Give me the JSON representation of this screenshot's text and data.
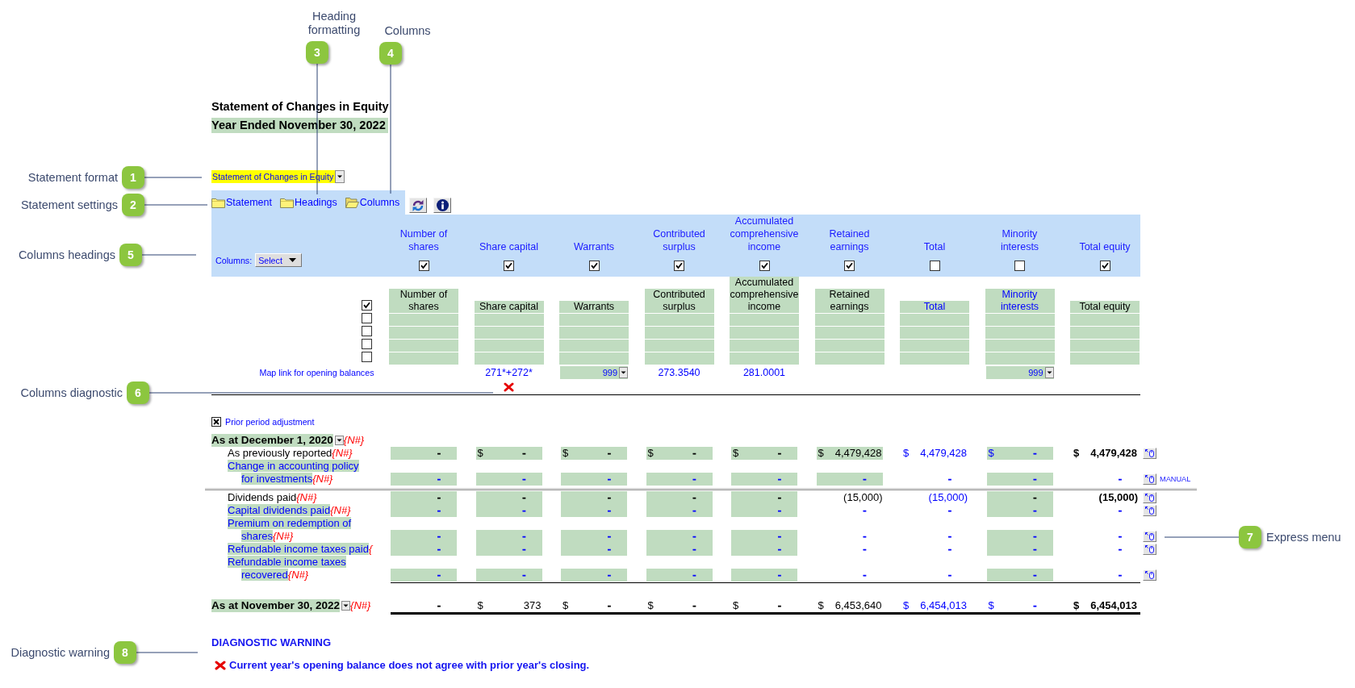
{
  "callouts": [
    {
      "number": "1",
      "label": "Statement format"
    },
    {
      "number": "2",
      "label": "Statement settings"
    },
    {
      "number": "3",
      "label": "Heading formatting"
    },
    {
      "number": "4",
      "label": "Columns"
    },
    {
      "number": "5",
      "label": "Columns headings"
    },
    {
      "number": "6",
      "label": "Columns diagnostic"
    },
    {
      "number": "7",
      "label": "Express menu"
    },
    {
      "number": "8",
      "label": "Diagnostic warning"
    }
  ],
  "title": "Statement of Changes in Equity",
  "period": "Year Ended November 30, 2022",
  "format_dropdown": {
    "value": "Statement of Changes in Equity"
  },
  "settings_links": [
    {
      "label": "Statement",
      "selected": false
    },
    {
      "label": "Headings",
      "selected": false
    },
    {
      "label": "Columns",
      "selected": true
    }
  ],
  "column_panel": {
    "label": "Columns:",
    "select": "Select",
    "columns": [
      {
        "heading": "Number of shares",
        "checked": true
      },
      {
        "heading": "Share capital",
        "checked": true
      },
      {
        "heading": "Warrants",
        "checked": true
      },
      {
        "heading": "Contributed surplus",
        "checked": true
      },
      {
        "heading": "Accumulated comprehensive income",
        "checked": true
      },
      {
        "heading": "Retained earnings",
        "checked": true
      },
      {
        "heading": "Total",
        "checked": false
      },
      {
        "heading": "Minority interests",
        "checked": false
      },
      {
        "heading": "Total equity",
        "checked": true
      }
    ]
  },
  "heading_rows": {
    "checkboxes": [
      {
        "checked": true
      },
      {
        "checked": false
      },
      {
        "checked": false
      },
      {
        "checked": false
      },
      {
        "checked": false
      }
    ],
    "headings": [
      {
        "label": "Number of shares",
        "color": "#000000"
      },
      {
        "label": "Share capital",
        "color": "#000000"
      },
      {
        "label": "Warrants",
        "color": "#000000"
      },
      {
        "label": "Contributed surplus",
        "color": "#000000"
      },
      {
        "label": "Accumulated comprehensive income",
        "color": "#000000"
      },
      {
        "label": "Retained earnings",
        "color": "#000000"
      },
      {
        "label": "Total",
        "color": "#0000ff"
      },
      {
        "label": "Minority interests",
        "color": "#0000ff"
      },
      {
        "label": "Total equity",
        "color": "#000000"
      }
    ]
  },
  "map_row": {
    "label": "Map link for opening balances",
    "cells": [
      {
        "kind": "blank"
      },
      {
        "kind": "text",
        "value": "271*+272*",
        "error": true
      },
      {
        "kind": "dropdown",
        "value": "999",
        "error": false
      },
      {
        "kind": "text",
        "value": "273.3540",
        "error": false
      },
      {
        "kind": "text",
        "value": "281.0001",
        "error": false
      },
      {
        "kind": "blank"
      },
      {
        "kind": "blank"
      },
      {
        "kind": "dropdown",
        "value": "999",
        "error": false
      },
      {
        "kind": "blank"
      }
    ]
  },
  "prior_period": {
    "label": "Prior period adjustment",
    "checked": true
  },
  "rows": [
    {
      "kind": "balance",
      "label": "As at December 1, 2020",
      "marker": "{N#}"
    },
    {
      "kind": "item",
      "label": "As previously reported",
      "color": "#000000",
      "input": false,
      "marker": "{N#}",
      "cells": [
        {
          "value": "-",
          "input": true,
          "color": "#000000"
        },
        {
          "currency": "$",
          "value": "-",
          "input": true,
          "color": "#000000"
        },
        {
          "currency": "$",
          "value": "-",
          "input": true,
          "color": "#000000"
        },
        {
          "currency": "$",
          "value": "-",
          "input": true,
          "color": "#000000"
        },
        {
          "currency": "$",
          "value": "-",
          "input": true,
          "color": "#000000"
        },
        {
          "currency": "$",
          "value": "4,479,428",
          "input": true,
          "color": "#000000"
        },
        {
          "currency": "$",
          "value": "4,479,428",
          "input": false,
          "color": "#0000ff"
        },
        {
          "currency": "$",
          "value": "-",
          "input": true,
          "color": "#0000ff"
        },
        {
          "currency": "$",
          "value": "4,479,428",
          "input": false,
          "color": "#000000"
        }
      ]
    },
    {
      "kind": "item",
      "label": "Change in accounting policy for investments",
      "color": "#0000ff",
      "input": true,
      "marker": "{N#}",
      "note": "MANUAL",
      "cells": [
        {
          "value": "-",
          "input": true,
          "color": "#0000ff"
        },
        {
          "value": "-",
          "input": true,
          "color": "#0000ff"
        },
        {
          "value": "-",
          "input": true,
          "color": "#0000ff"
        },
        {
          "value": "-",
          "input": true,
          "color": "#0000ff"
        },
        {
          "value": "-",
          "input": true,
          "color": "#0000ff"
        },
        {
          "value": "-",
          "input": true,
          "color": "#0000ff"
        },
        {
          "value": "-",
          "input": false,
          "color": "#0000ff"
        },
        {
          "value": "-",
          "input": true,
          "color": "#0000ff"
        },
        {
          "value": "-",
          "input": false,
          "color": "#0000ff"
        }
      ]
    },
    {
      "kind": "break"
    },
    {
      "kind": "item",
      "label": "Dividends paid",
      "color": "#000000",
      "input": false,
      "marker": "{N#}",
      "cells": [
        {
          "value": "-",
          "input": true,
          "color": "#000000"
        },
        {
          "value": "-",
          "input": true,
          "color": "#000000"
        },
        {
          "value": "-",
          "input": true,
          "color": "#000000"
        },
        {
          "value": "-",
          "input": true,
          "color": "#000000"
        },
        {
          "value": "-",
          "input": true,
          "color": "#000000"
        },
        {
          "value": "(15,000)",
          "input": false,
          "color": "#000000"
        },
        {
          "value": "(15,000)",
          "input": false,
          "color": "#0000ff"
        },
        {
          "value": "-",
          "input": true,
          "color": "#000000"
        },
        {
          "value": "(15,000)",
          "input": false,
          "color": "#000000"
        }
      ]
    },
    {
      "kind": "item",
      "label": "Capital dividends paid",
      "color": "#0000ff",
      "input": true,
      "marker": "{N#}",
      "cells": [
        {
          "value": "-",
          "input": true,
          "color": "#0000ff"
        },
        {
          "value": "-",
          "input": true,
          "color": "#0000ff"
        },
        {
          "value": "-",
          "input": true,
          "color": "#0000ff"
        },
        {
          "value": "-",
          "input": true,
          "color": "#0000ff"
        },
        {
          "value": "-",
          "input": true,
          "color": "#0000ff"
        },
        {
          "value": "-",
          "input": false,
          "color": "#0000ff"
        },
        {
          "value": "-",
          "input": false,
          "color": "#0000ff"
        },
        {
          "value": "-",
          "input": true,
          "color": "#0000ff"
        },
        {
          "value": "-",
          "input": false,
          "color": "#0000ff"
        }
      ]
    },
    {
      "kind": "item",
      "label": "Premium on redemption of shares",
      "color": "#0000ff",
      "input": true,
      "marker": "{N#}",
      "cells": [
        {
          "value": "-",
          "input": true,
          "color": "#0000ff"
        },
        {
          "value": "-",
          "input": true,
          "color": "#0000ff"
        },
        {
          "value": "-",
          "input": true,
          "color": "#0000ff"
        },
        {
          "value": "-",
          "input": true,
          "color": "#0000ff"
        },
        {
          "value": "-",
          "input": true,
          "color": "#0000ff"
        },
        {
          "value": "-",
          "input": false,
          "color": "#0000ff"
        },
        {
          "value": "-",
          "input": false,
          "color": "#0000ff"
        },
        {
          "value": "-",
          "input": true,
          "color": "#0000ff"
        },
        {
          "value": "-",
          "input": false,
          "color": "#0000ff"
        }
      ]
    },
    {
      "kind": "item",
      "label": "Refundable income taxes paid",
      "color": "#0000ff",
      "input": true,
      "marker": "{",
      "cells": [
        {
          "value": "-",
          "input": true,
          "color": "#0000ff"
        },
        {
          "value": "-",
          "input": true,
          "color": "#0000ff"
        },
        {
          "value": "-",
          "input": true,
          "color": "#0000ff"
        },
        {
          "value": "-",
          "input": true,
          "color": "#0000ff"
        },
        {
          "value": "-",
          "input": true,
          "color": "#0000ff"
        },
        {
          "value": "-",
          "input": false,
          "color": "#0000ff"
        },
        {
          "value": "-",
          "input": false,
          "color": "#0000ff"
        },
        {
          "value": "-",
          "input": true,
          "color": "#0000ff"
        },
        {
          "value": "-",
          "input": false,
          "color": "#0000ff"
        }
      ]
    },
    {
      "kind": "item",
      "label": "Refundable income taxes recovered",
      "color": "#0000ff",
      "input": true,
      "marker": "{N#}",
      "cells": [
        {
          "value": "-",
          "input": true,
          "color": "#0000ff"
        },
        {
          "value": "-",
          "input": true,
          "color": "#0000ff"
        },
        {
          "value": "-",
          "input": true,
          "color": "#0000ff"
        },
        {
          "value": "-",
          "input": true,
          "color": "#0000ff"
        },
        {
          "value": "-",
          "input": true,
          "color": "#0000ff"
        },
        {
          "value": "-",
          "input": false,
          "color": "#0000ff"
        },
        {
          "value": "-",
          "input": false,
          "color": "#0000ff"
        },
        {
          "value": "-",
          "input": true,
          "color": "#0000ff"
        },
        {
          "value": "-",
          "input": false,
          "color": "#0000ff"
        }
      ]
    },
    {
      "kind": "balance",
      "label": "As at November 30, 2022",
      "marker": "{N#}",
      "cells": [
        {
          "value": "-",
          "input": false,
          "color": "#000000"
        },
        {
          "currency": "$",
          "value": "373",
          "input": false,
          "color": "#000000"
        },
        {
          "currency": "$",
          "value": "-",
          "input": false,
          "color": "#000000"
        },
        {
          "currency": "$",
          "value": "-",
          "input": false,
          "color": "#000000"
        },
        {
          "currency": "$",
          "value": "-",
          "input": false,
          "color": "#000000"
        },
        {
          "currency": "$",
          "value": "6,453,640",
          "input": false,
          "color": "#000000"
        },
        {
          "currency": "$",
          "value": "6,454,013",
          "input": false,
          "color": "#0000ff"
        },
        {
          "currency": "$",
          "value": "-",
          "input": false,
          "color": "#0000ff"
        },
        {
          "currency": "$",
          "value": "6,454,013",
          "input": false,
          "color": "#000000"
        }
      ]
    }
  ],
  "diagnostic": {
    "title": "DIAGNOSTIC WARNING",
    "message": "Current year's opening balance does not agree with prior year's closing."
  }
}
